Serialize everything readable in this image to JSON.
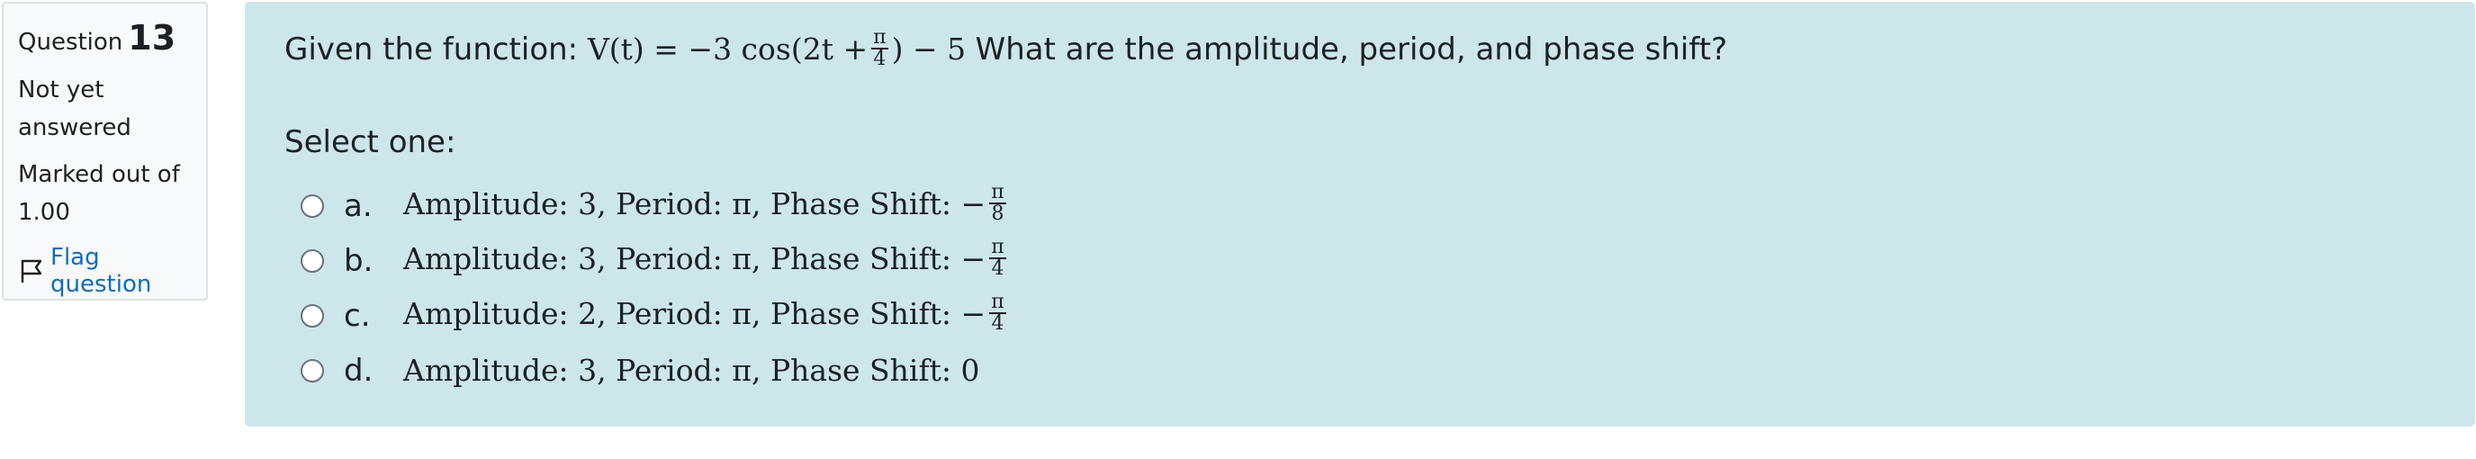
{
  "question_info": {
    "label": "Question",
    "number": "13",
    "state": "Not yet answered",
    "grade": "Marked out of 1.00",
    "flag_label": "Flag question"
  },
  "question": {
    "prefix": "Given the function:",
    "formula_lhs": "V(t) = −3 cos(2t +",
    "formula_frac_num": "π",
    "formula_frac_den": "4",
    "formula_rhs": ") − 5",
    "suffix": "What are the amplitude, period, and phase shift?"
  },
  "prompt": "Select one:",
  "answers": [
    {
      "letter": "a.",
      "text": "Amplitude: 3,  Period: π,  Phase Shift:  −",
      "frac_num": "π",
      "frac_den": "8"
    },
    {
      "letter": "b.",
      "text": "Amplitude: 3,  Period: π,  Phase Shift:  −",
      "frac_num": "π",
      "frac_den": "4"
    },
    {
      "letter": "c.",
      "text": "Amplitude: 2,  Period: π,  Phase Shift:  −",
      "frac_num": "π",
      "frac_den": "4"
    },
    {
      "letter": "d.",
      "text": "Amplitude: 3,  Period: π,  Phase Shift: 0"
    }
  ],
  "colors": {
    "content_bg": "#cce6ea",
    "info_bg": "#f8f9fa",
    "link": "#0f6cbf"
  }
}
